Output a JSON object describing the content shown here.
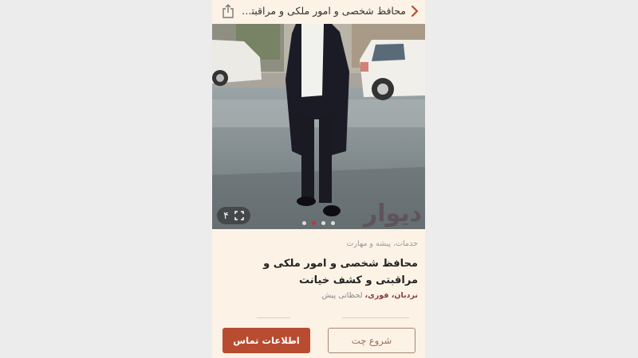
{
  "header": {
    "title": "محافظ شخصی و امور ملکی و مراقبتی و...",
    "back_icon": "chevron-right-icon",
    "share_icon": "share-icon"
  },
  "gallery": {
    "photo_count": "۴",
    "expand_icon": "expand-icon",
    "watermark": "دیوار",
    "dots": 4,
    "active_dot": 2
  },
  "listing": {
    "category": "خدمات، پیشه و مهارت",
    "title": "محافظ شخصی و امور ملکی و مراقبتی و کشف خیانت",
    "tag_strong": "نردبان، فوری،",
    "tag_light": "لحظاتی پیش"
  },
  "actions": {
    "contact_label": "اطلاعات تماس",
    "chat_label": "شروع چت"
  },
  "colors": {
    "background": "#fcf3e6",
    "accent": "#b84c31",
    "active_dot": "#c0392b"
  }
}
